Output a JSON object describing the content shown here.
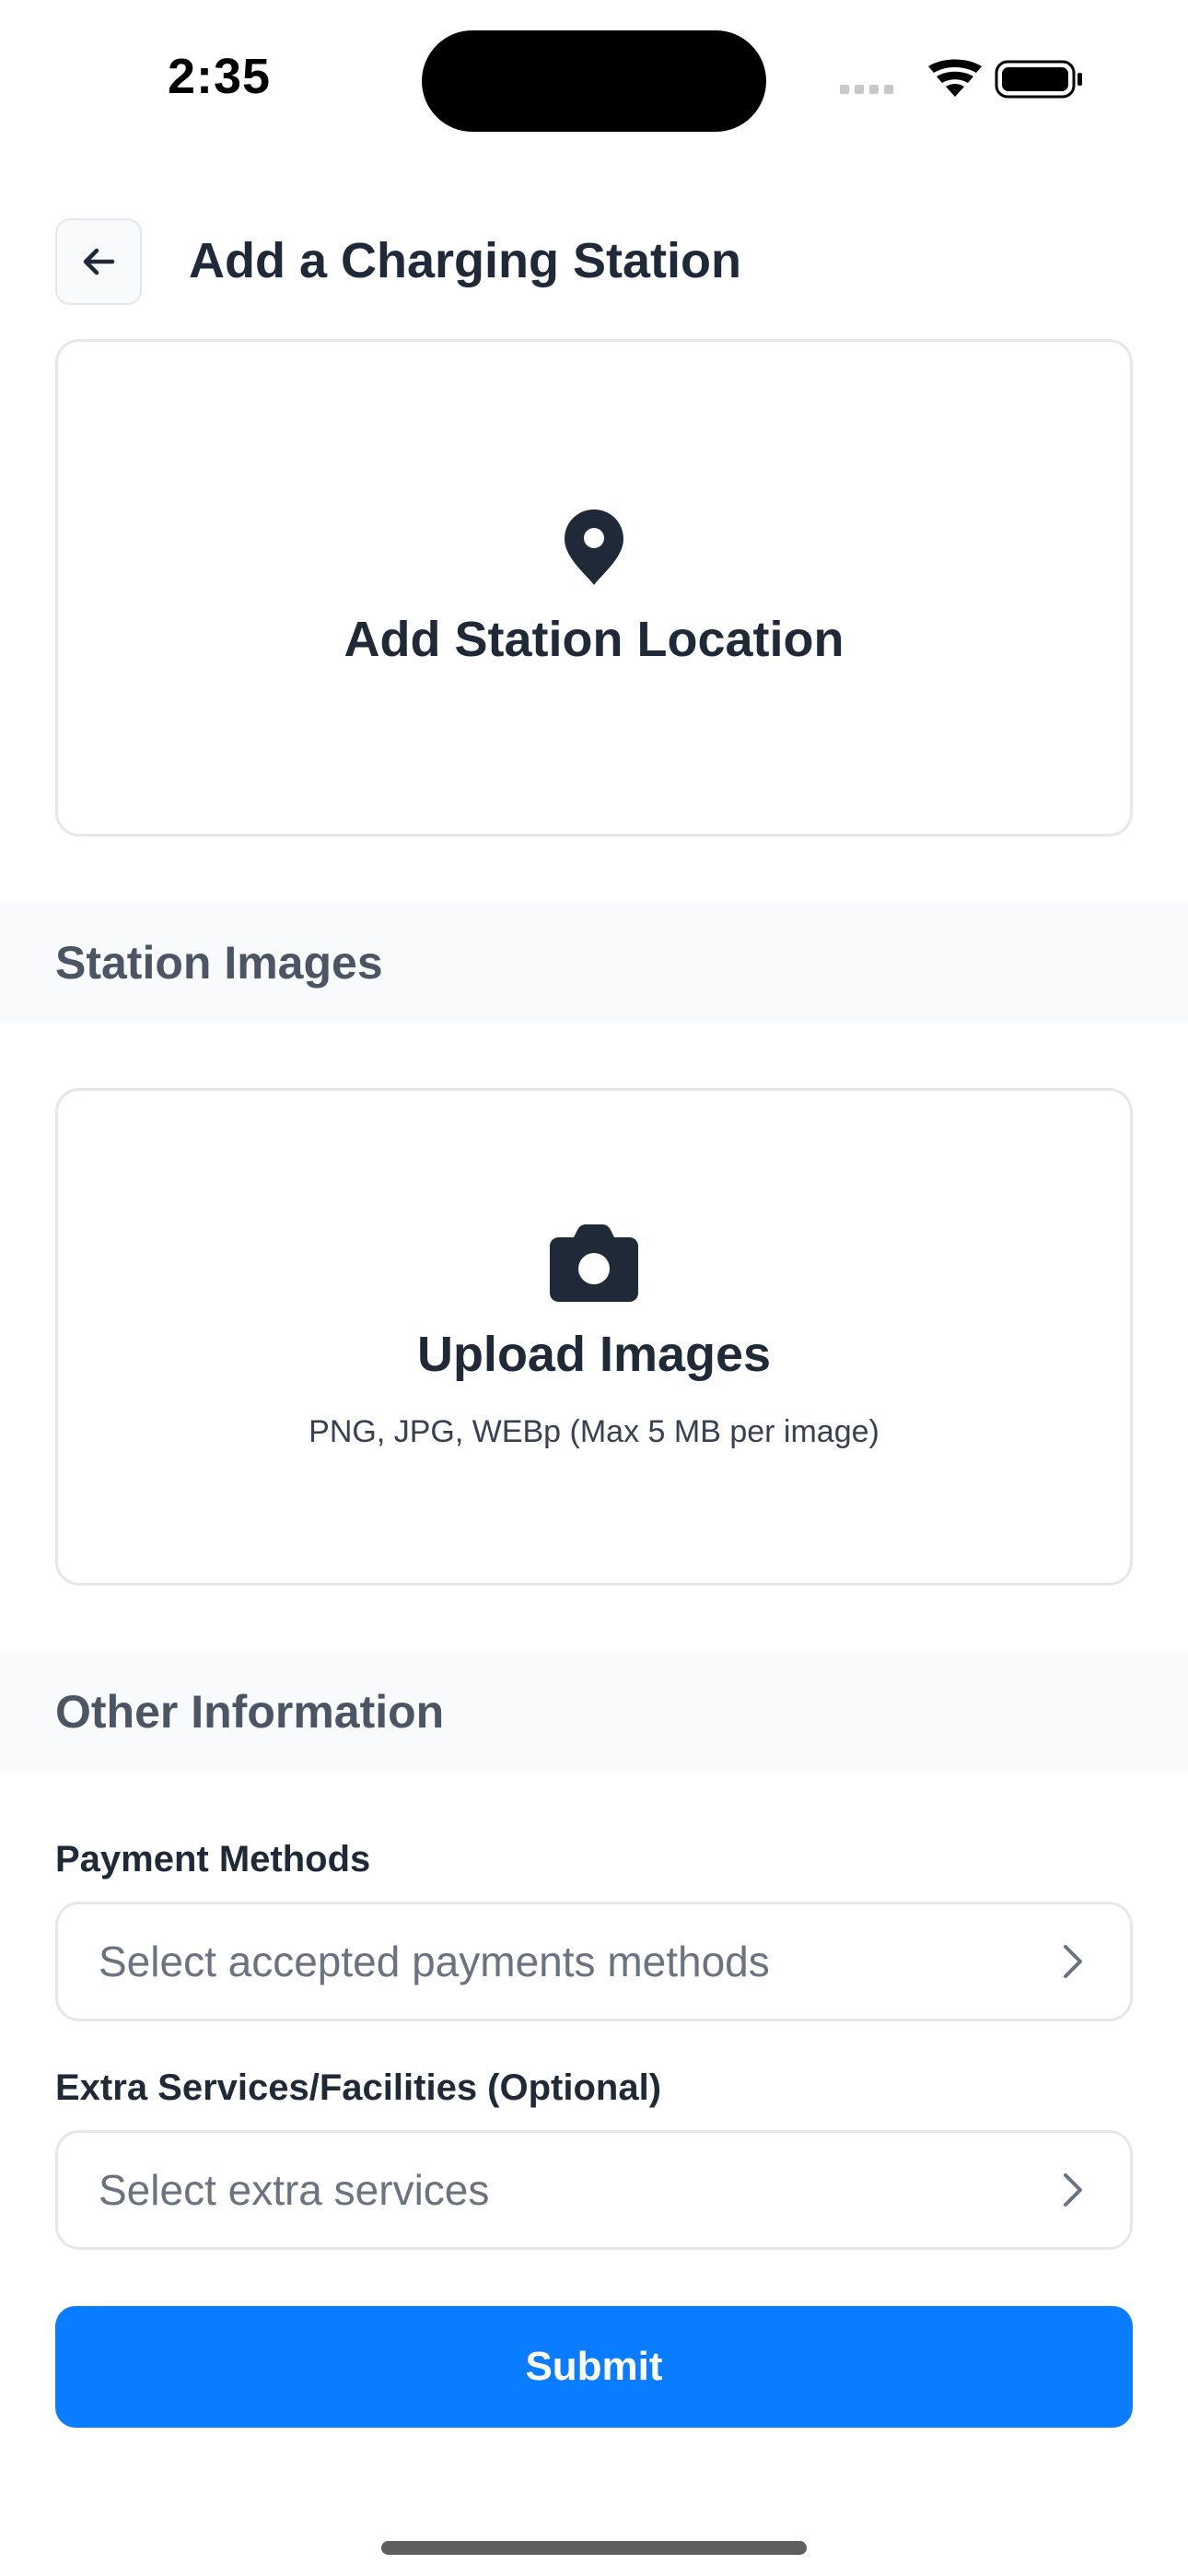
{
  "status_bar": {
    "time": "2:35",
    "icons": [
      "cellular-signal-icon",
      "wifi-icon",
      "battery-icon"
    ]
  },
  "header": {
    "title": "Add a Charging Station",
    "back_icon": "arrow-left-icon"
  },
  "location_card": {
    "icon": "map-pin-icon",
    "title": "Add Station Location"
  },
  "images_section": {
    "heading": "Station Images",
    "upload": {
      "icon": "camera-icon",
      "title": "Upload Images",
      "subtitle": "PNG, JPG, WEBp (Max 5 MB per image)"
    }
  },
  "other_section": {
    "heading": "Other Information",
    "payment": {
      "label": "Payment Methods",
      "placeholder": "Select accepted payments methods",
      "icon": "chevron-right-icon"
    },
    "extra": {
      "label": "Extra Services/Facilities (Optional)",
      "placeholder": "Select extra services",
      "icon": "chevron-right-icon"
    }
  },
  "submit_label": "Submit",
  "colors": {
    "primary": "#0a7cff",
    "text": "#1f2937",
    "muted": "#6b7280",
    "border": "#e5e7eb",
    "section_bg": "#f8fafc"
  }
}
